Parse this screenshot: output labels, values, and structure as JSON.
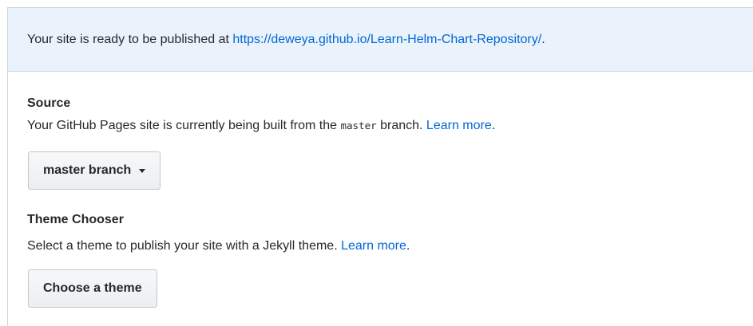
{
  "flash": {
    "prefix": "Your site is ready to be published at ",
    "url": "https://deweya.github.io/Learn-Helm-Chart-Repository/",
    "suffix": "."
  },
  "source": {
    "title": "Source",
    "desc_prefix": "Your GitHub Pages site is currently being built from the ",
    "branch_code": "master",
    "desc_middle": " branch. ",
    "learn_more": "Learn more",
    "desc_suffix": ".",
    "button_label": "master branch"
  },
  "theme": {
    "title": "Theme Chooser",
    "desc_prefix": "Select a theme to publish your site with a Jekyll theme. ",
    "learn_more": "Learn more",
    "desc_suffix": ".",
    "button_label": "Choose a theme"
  }
}
